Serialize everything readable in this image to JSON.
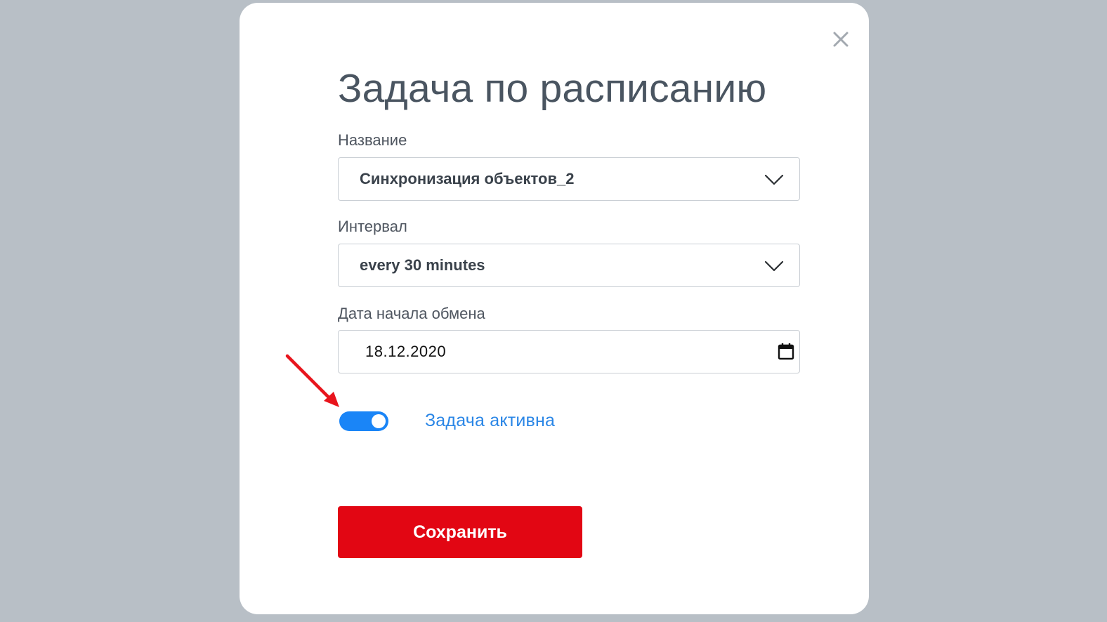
{
  "modal": {
    "title": "Задача по расписанию",
    "close_icon": "close-icon"
  },
  "fields": {
    "name": {
      "label": "Название",
      "value": "Синхронизация объектов_2",
      "icon": "chevron-down-icon"
    },
    "interval": {
      "label": "Интервал",
      "value": "every 30 minutes",
      "icon": "chevron-down-icon"
    },
    "start_date": {
      "label": "Дата начала обмена",
      "value": "18.12.2020",
      "icon": "calendar-icon"
    }
  },
  "active_toggle": {
    "label": "Задача активна",
    "checked": true,
    "color": "#1a85f7"
  },
  "save_button": {
    "label": "Сохранить",
    "color": "#e20613"
  },
  "annotation": {
    "icon": "red-arrow-icon",
    "color": "#e8141c"
  }
}
